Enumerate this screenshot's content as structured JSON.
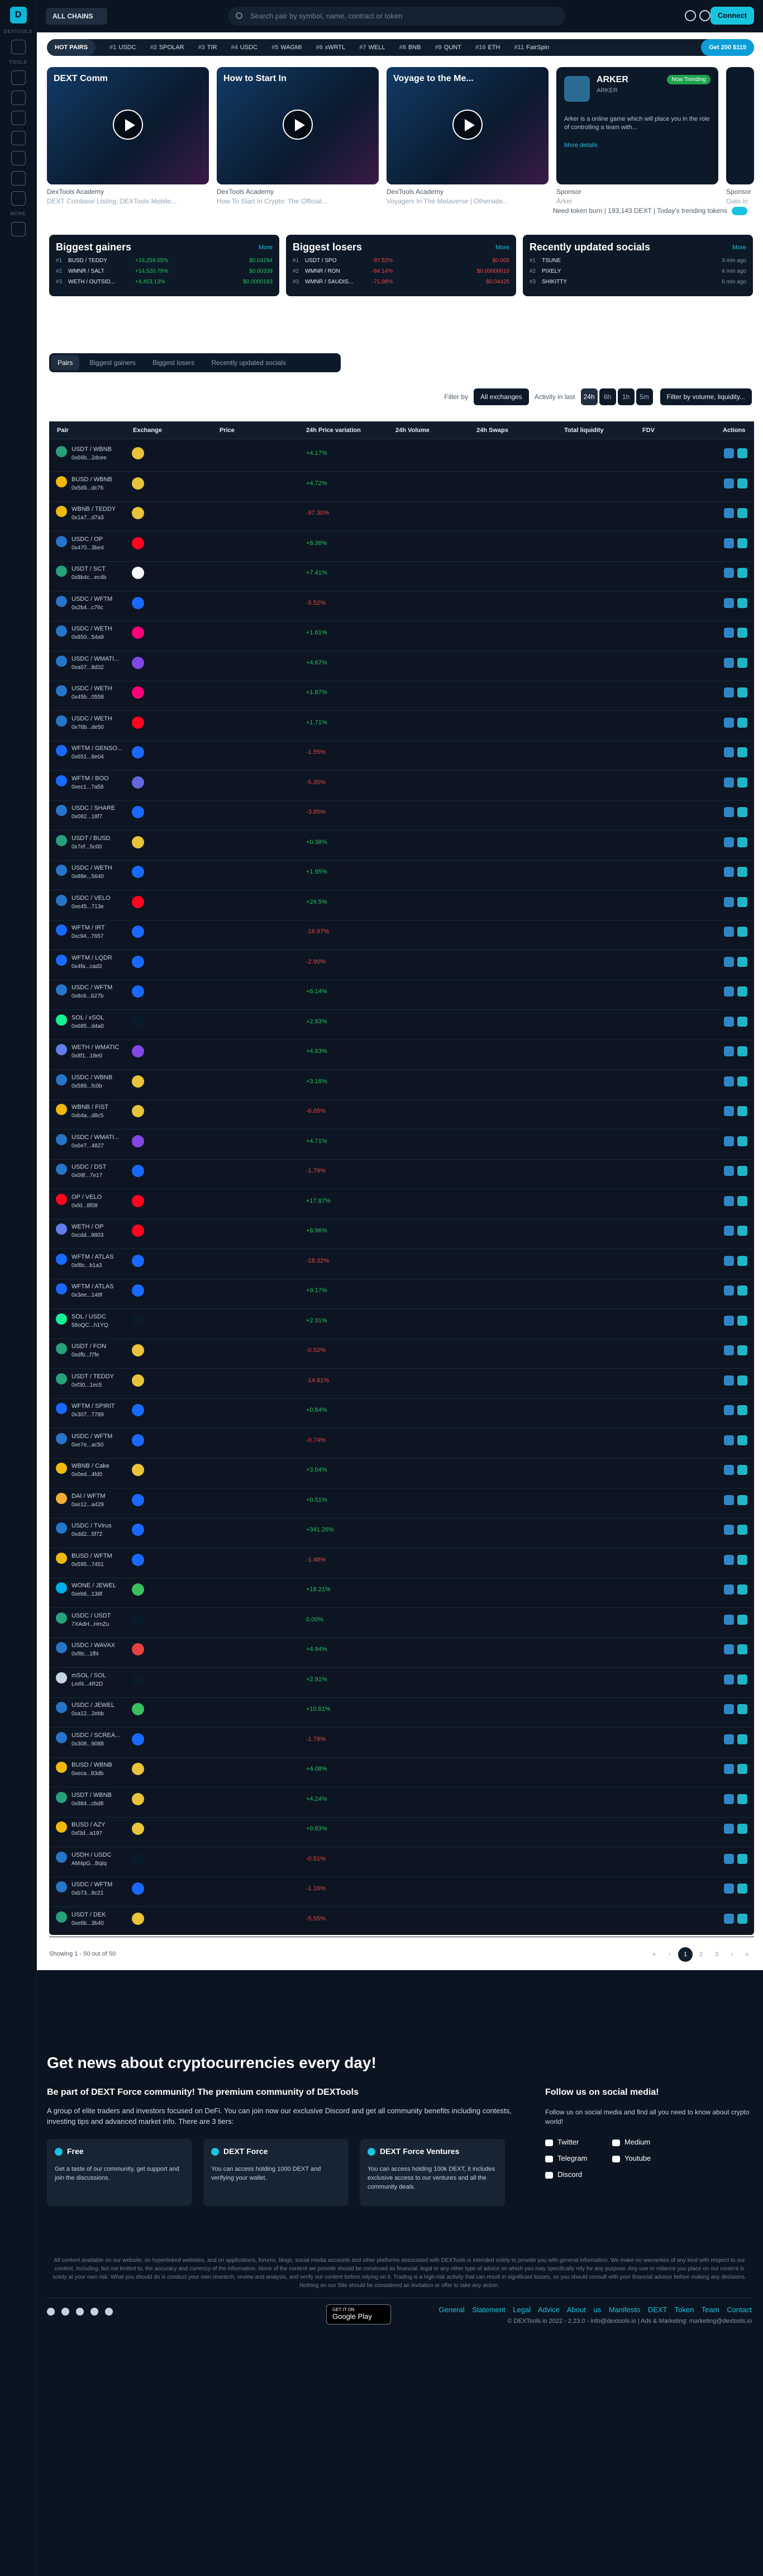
{
  "nav": {
    "chains": "ALL CHAINS",
    "search_placeholder": "Search pair by symbol, name, contract or token",
    "connect": "Connect",
    "sidebar_labels": [
      "DEXTOOLS",
      "TOOLS",
      "MORE"
    ]
  },
  "hotpairs": {
    "label": "HOT PAIRS",
    "items": [
      {
        "rank": "#1",
        "sym": "USDC"
      },
      {
        "rank": "#2",
        "sym": "SPOLAR"
      },
      {
        "rank": "#3",
        "sym": "TIR"
      },
      {
        "rank": "#4",
        "sym": "USDC"
      },
      {
        "rank": "#5",
        "sym": "WAGMI"
      },
      {
        "rank": "#6",
        "sym": "xWRTL"
      },
      {
        "rank": "#7",
        "sym": "WELL"
      },
      {
        "rank": "#8",
        "sym": "BNB"
      },
      {
        "rank": "#9",
        "sym": "QUNT"
      },
      {
        "rank": "#10",
        "sym": "ETH"
      },
      {
        "rank": "#11",
        "sym": "FairSpin"
      }
    ],
    "dext": "Get 200 $115"
  },
  "videos": [
    {
      "title": "DEXT Comm",
      "source": "DexTools Academy",
      "sub": "DEXT Coinbase Listing, DEXTools Mobile..."
    },
    {
      "title": "How to Start In",
      "source": "DexTools Academy",
      "sub": "How To Start In Crypto: The Official..."
    },
    {
      "title": "Voyage to the Me...",
      "source": "DexTools Academy",
      "sub": "Voyagers In The Metaverse | Otherside..."
    }
  ],
  "sponsor": {
    "name": "ARKER",
    "sub": "ARKER",
    "tag": "Now Trending",
    "desc": "Arker is a online game which will place you in the role of controlling a team with...",
    "more": "More details",
    "source": "Sponsor",
    "sub2": "Arker",
    "source2": "Sponsor",
    "sub3": "Gate.io"
  },
  "trending": {
    "need": "Need token burn | 193,143 DEXT",
    "today": "Today's trending tokens"
  },
  "gainers": {
    "title": "Biggest gainers",
    "more": "More",
    "rows": [
      {
        "rank": "#1",
        "pair": "BUSD / TEDDY",
        "pct": "+16,259.05%",
        "val": "$0.04294"
      },
      {
        "rank": "#2",
        "pair": "WMNR / SALT",
        "pct": "+14,520.79%",
        "val": "$0.00339"
      },
      {
        "rank": "#3",
        "pair": "WETH / OUTSID...",
        "pct": "+4,453.13%",
        "val": "$0.0000183"
      }
    ]
  },
  "losers": {
    "title": "Biggest losers",
    "more": "More",
    "rows": [
      {
        "rank": "#1",
        "pair": "USDT / SPO",
        "pct": "-97.52%",
        "val": "$0.005"
      },
      {
        "rank": "#2",
        "pair": "WMNR / RON",
        "pct": "-84.14%",
        "val": "$0.00000010"
      },
      {
        "rank": "#3",
        "pair": "WMNR / SAUDIS...",
        "pct": "-71.08%",
        "val": "$0.04425"
      }
    ]
  },
  "socials": {
    "title": "Recently updated socials",
    "more": "More",
    "rows": [
      {
        "rank": "#1",
        "name": "TSUNE",
        "age": "3 min ago"
      },
      {
        "rank": "#2",
        "name": "PIXELY",
        "age": "4 min ago"
      },
      {
        "rank": "#3",
        "name": "SHIKITTY",
        "age": "6 min ago"
      }
    ]
  },
  "tabs": [
    "Pairs",
    "Biggest gainers",
    "Biggest losers",
    "Recently updated socials"
  ],
  "filters": {
    "filter_by": "Filter by",
    "exchanges": "All exchanges",
    "activity": "Activity in last",
    "periods": [
      "24h",
      "6h",
      "1h",
      "5m"
    ],
    "volume": "Filter by volume, liquidity..."
  },
  "columns": [
    "Pair",
    "Exchange",
    "Price",
    "24h Price variation",
    "24h Volume",
    "24h Swaps",
    "Total liquidity",
    "FDV",
    "Actions"
  ],
  "rows": [
    {
      "pair": "USDT / WBNB",
      "addr": "0x66b...2dcee",
      "pct": "+4.17%",
      "c": "#26a17b",
      "e": "#e8c33b"
    },
    {
      "pair": "BUSD / WBNB",
      "addr": "0x5d9...dc76",
      "pct": "+4.72%",
      "c": "#f0b90b",
      "e": "#e8c33b"
    },
    {
      "pair": "WBNB / TEDDY",
      "addr": "0x1a7...d7a3",
      "pct": "-97.30%",
      "c": "#f0b90b",
      "e": "#e8c33b"
    },
    {
      "pair": "USDC / OP",
      "addr": "0x470...3be4",
      "pct": "+8.36%",
      "c": "#2775ca",
      "e": "#ff0420"
    },
    {
      "pair": "USDT / SCT",
      "addr": "0x8b4c...ec4b",
      "pct": "+7.41%",
      "c": "#26a17b",
      "e": "#f7f7ff"
    },
    {
      "pair": "USDC / WFTM",
      "addr": "0x2b4...c76c",
      "pct": "-5.52%",
      "c": "#2775ca",
      "e": "#1969ff"
    },
    {
      "pair": "USDC / WETH",
      "addr": "0x850...54a9",
      "pct": "+1.61%",
      "c": "#2775ca",
      "e": "#ff007a"
    },
    {
      "pair": "USDC / WMATI...",
      "addr": "0xa07...8d32",
      "pct": "+4.67%",
      "c": "#2775ca",
      "e": "#8247e5"
    },
    {
      "pair": "USDC / WETH",
      "addr": "0x45b...0558",
      "pct": "+1.87%",
      "c": "#2775ca",
      "e": "#ff007a"
    },
    {
      "pair": "USDC / WETH",
      "addr": "0x76b...de50",
      "pct": "+1.71%",
      "c": "#2775ca",
      "e": "#ff0420"
    },
    {
      "pair": "WFTM / GENSO...",
      "addr": "0x651...8e04",
      "pct": "-1.55%",
      "c": "#1969ff",
      "e": "#1969ff"
    },
    {
      "pair": "WFTM / BOO",
      "addr": "0xec1...7a58",
      "pct": "-5.35%",
      "c": "#1969ff",
      "e": "#6665dd"
    },
    {
      "pair": "USDC / SHARE",
      "addr": "0x082...18f7",
      "pct": "-3.85%",
      "c": "#2775ca",
      "e": "#1969ff"
    },
    {
      "pair": "USDT / BUSD",
      "addr": "0x7ef...5c00",
      "pct": "+0.38%",
      "c": "#26a17b",
      "e": "#e8c33b"
    },
    {
      "pair": "USDC / WETH",
      "addr": "0x88e...5640",
      "pct": "+1.95%",
      "c": "#2775ca",
      "e": "#1969ff"
    },
    {
      "pair": "USDC / VELO",
      "addr": "0xe45...713e",
      "pct": "+24.5%",
      "c": "#2775ca",
      "e": "#ff0420"
    },
    {
      "pair": "WFTM / IRT",
      "addr": "0xc94...7657",
      "pct": "-16.97%",
      "c": "#1969ff",
      "e": "#1969ff"
    },
    {
      "pair": "WFTM / LQDR",
      "addr": "0x4fa...cad3",
      "pct": "-2.90%",
      "c": "#1969ff",
      "e": "#1969ff"
    },
    {
      "pair": "USDC / WFTM",
      "addr": "0x8c6...b27b",
      "pct": "+6.14%",
      "c": "#2775ca",
      "e": "#1969ff"
    },
    {
      "pair": "SOL / xSOL",
      "addr": "0x685...d4a0",
      "pct": "+2.93%",
      "c": "#14f195",
      "e": "#0b1a2b"
    },
    {
      "pair": "WETH / WMATIC",
      "addr": "0x8f1...18e0",
      "pct": "+4.83%",
      "c": "#627eea",
      "e": "#8247e5"
    },
    {
      "pair": "USDC / WBNB",
      "addr": "0x589...fc0b",
      "pct": "+3.16%",
      "c": "#2775ca",
      "e": "#e8c33b"
    },
    {
      "pair": "WBNB / FIST",
      "addr": "0xb4a...d8c5",
      "pct": "-6.05%",
      "c": "#f0b90b",
      "e": "#e8c33b"
    },
    {
      "pair": "USDC / WMATI...",
      "addr": "0x6e7...4827",
      "pct": "+4.71%",
      "c": "#2775ca",
      "e": "#8247e5"
    },
    {
      "pair": "USDC / DST",
      "addr": "0x09f...7e17",
      "pct": "-1.79%",
      "c": "#2775ca",
      "e": "#1969ff"
    },
    {
      "pair": "OP / VELO",
      "addr": "0xfd...8f08",
      "pct": "+17.87%",
      "c": "#ff0420",
      "e": "#ff0420"
    },
    {
      "pair": "WETH / OP",
      "addr": "0xcdd...9803",
      "pct": "+8.96%",
      "c": "#627eea",
      "e": "#ff0420"
    },
    {
      "pair": "WFTM / ATLAS",
      "addr": "0xf8c...b1a3",
      "pct": "-18.32%",
      "c": "#1969ff",
      "e": "#1969ff"
    },
    {
      "pair": "WFTM / ATLAS",
      "addr": "0x3ee...148f",
      "pct": "+9.17%",
      "c": "#1969ff",
      "e": "#1969ff"
    },
    {
      "pair": "SOL / USDC",
      "addr": "58oQC...h1YQ",
      "pct": "+2.31%",
      "c": "#14f195",
      "e": "#0b1a2b"
    },
    {
      "pair": "USDT / FON",
      "addr": "0xdfb...f7fe",
      "pct": "-0.52%",
      "c": "#26a17b",
      "e": "#e8c33b"
    },
    {
      "pair": "USDT / TEDDY",
      "addr": "0xf30...1ec5",
      "pct": "-14.81%",
      "c": "#26a17b",
      "e": "#e8c33b"
    },
    {
      "pair": "WFTM / SPIRIT",
      "addr": "0x307...7789",
      "pct": "+0.84%",
      "c": "#1969ff",
      "e": "#1969ff"
    },
    {
      "pair": "USDC / WFTM",
      "addr": "0xe7e...ac50",
      "pct": "-0.74%",
      "c": "#2775ca",
      "e": "#1969ff"
    },
    {
      "pair": "WBNB / Cake",
      "addr": "0x0ed...4fd0",
      "pct": "+3.04%",
      "c": "#f0b90b",
      "e": "#e8c33b"
    },
    {
      "pair": "DAI / WFTM",
      "addr": "0xe12...a429",
      "pct": "+0.51%",
      "c": "#f5ac37",
      "e": "#1969ff"
    },
    {
      "pair": "USDC / TVirus",
      "addr": "0xdd2...5f72",
      "pct": "+341.26%",
      "c": "#2775ca",
      "e": "#1969ff"
    },
    {
      "pair": "BUSD / WFTM",
      "addr": "0x595...7451",
      "pct": "-1.48%",
      "c": "#f0b90b",
      "e": "#1969ff"
    },
    {
      "pair": "WONE / JEWEL",
      "addr": "0xeb6...138f",
      "pct": "+18.21%",
      "c": "#00aee9",
      "e": "#3bbf5e"
    },
    {
      "pair": "USDC / USDT",
      "addr": "7XAdH...HmZu",
      "pct": "0.00%",
      "c": "#26a17b",
      "e": "#0b1a2b"
    },
    {
      "pair": "USDC / WAVAX",
      "addr": "0xf8c...1ff4",
      "pct": "+4.94%",
      "c": "#2775ca",
      "e": "#e84142"
    },
    {
      "pair": "mSOL / SOL",
      "addr": "Lmf4...4R2D",
      "pct": "+2.91%",
      "c": "#c7d3de",
      "e": "#0b1a2b"
    },
    {
      "pair": "USDC / JEWEL",
      "addr": "0xa12...2ebb",
      "pct": "+10.61%",
      "c": "#2775ca",
      "e": "#3bbf5e"
    },
    {
      "pair": "USDC / SCREA...",
      "addr": "0x308...9088",
      "pct": "-1.78%",
      "c": "#2775ca",
      "e": "#1969ff"
    },
    {
      "pair": "BUSD / WBNB",
      "addr": "0xeca...83db",
      "pct": "+4.08%",
      "c": "#f0b90b",
      "e": "#e8c33b"
    },
    {
      "pair": "USDT / WBNB",
      "addr": "0x884...cbd8",
      "pct": "+4.24%",
      "c": "#26a17b",
      "e": "#e8c33b"
    },
    {
      "pair": "BUSD / AZY",
      "addr": "0xf3d...a197",
      "pct": "+9.83%",
      "c": "#f0b90b",
      "e": "#e8c33b"
    },
    {
      "pair": "USDH / USDC",
      "addr": "AM4pG...Bqtq",
      "pct": "-0.51%",
      "c": "#2775ca",
      "e": "#0b1a2b"
    },
    {
      "pair": "USDC / WFTM",
      "addr": "0xb73...8c21",
      "pct": "-1.16%",
      "c": "#2775ca",
      "e": "#1969ff"
    },
    {
      "pair": "USDT / DEK",
      "addr": "0xe6b...3b40",
      "pct": "-5.55%",
      "c": "#26a17b",
      "e": "#e8c33b"
    }
  ],
  "footer_table": {
    "showing": "Showing 1 - 50 out of 50",
    "pages": [
      "«",
      "‹",
      "1",
      "2",
      "3",
      "›",
      "»"
    ]
  },
  "footer": {
    "headline": "Get news about cryptocurrencies every day!",
    "community_title": "Be part of DEXT Force community! The premium community of DEXTools",
    "community_text": "A group of elite traders and investors focused on DeFi. You can join now our exclusive Discord and get all community benefits including contests, investing tips and advanced market info. There are 3 tiers:",
    "tiers": [
      {
        "name": "Free",
        "text": "Get a taste of our community, get support and join the discussions."
      },
      {
        "name": "DEXT Force",
        "text": "You can access holding 1000 DEXT and verifying your wallet."
      },
      {
        "name": "DEXT Force Ventures",
        "text": "You can access holding 100k DEXT, it includes exclusive access to our ventures and all the community deals."
      }
    ],
    "social_title": "Follow us on social media!",
    "social_text": "Follow us on social media and find all you need to know about crypto world!",
    "socials": [
      "Twitter",
      "Medium",
      "Telegram",
      "Youtube",
      "Discord"
    ],
    "disclaimer": "All content available on our website, on hyperlinked websites, and on applications, forums, blogs, social media accounts and other platforms associated with DEXTools is intended solely to provide you with general information. We make no warranties of any kind with respect to our content, including, but not limited to, the accuracy and currency of the information. None of the content we provide should be construed as financial, legal or any other type of advice on which you may specifically rely for any purpose. Any use or reliance you place on our content is solely at your own risk. What you should do is conduct your own research, review and analysis, and verify our content before relying on it. Trading is a high-risk activity that can result in significant losses, so you should consult with your financial advisor before making any decisions. Nothing on our Site should be considered an invitation or offer to take any action.",
    "links": [
      "General Statement",
      "Legal Advice",
      "About us",
      "Manifesto",
      "DEXT Token",
      "Team",
      "Contact"
    ],
    "copyright": "© DEXTools.io 2022 - 2.23.0 - info@dextools.io | Ads & Marketing: marketing@dextools.io",
    "gplay_small": "GET IT ON",
    "gplay": "Google Play"
  }
}
